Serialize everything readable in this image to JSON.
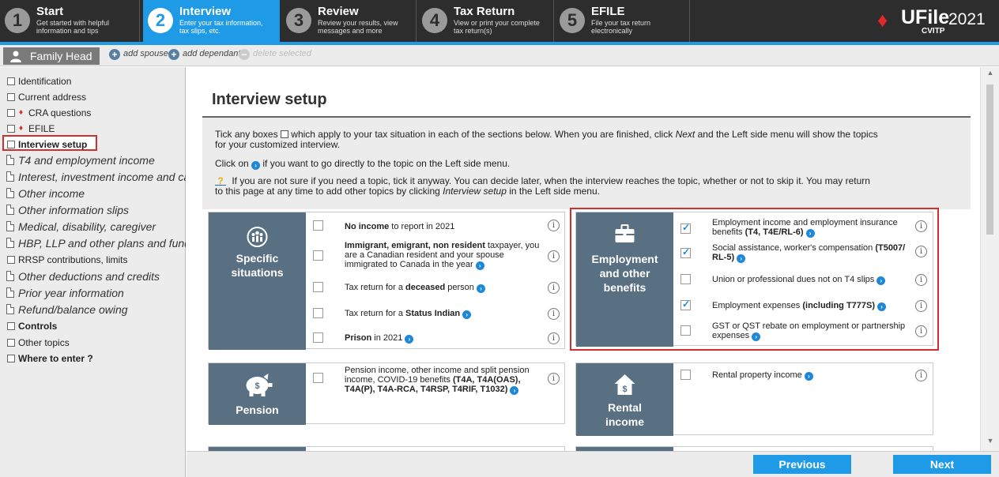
{
  "steps": [
    {
      "num": "1",
      "title": "Start",
      "sub1": "Get started with helpful",
      "sub2": "information and tips",
      "active": false
    },
    {
      "num": "2",
      "title": "Interview",
      "sub1": "Enter your tax information,",
      "sub2": "tax slips, etc.",
      "active": true
    },
    {
      "num": "3",
      "title": "Review",
      "sub1": "Review your results, view",
      "sub2": "messages and more",
      "active": false
    },
    {
      "num": "4",
      "title": "Tax Return",
      "sub1": "View or print your complete",
      "sub2": "tax return(s)",
      "active": false
    },
    {
      "num": "5",
      "title": "EFILE",
      "sub1": "File your tax return",
      "sub2": "electronically",
      "active": false
    }
  ],
  "logo": {
    "brand": "UFile",
    "year": "2021",
    "tag": "CVITP"
  },
  "family": {
    "tab": "Family Head",
    "add_spouse": "add spouse",
    "add_dependant": "add dependant",
    "delete_selected": "delete selected"
  },
  "nav": [
    {
      "label": "Identification",
      "icon": "box",
      "style": "normal"
    },
    {
      "label": "Current address",
      "icon": "box",
      "style": "normal"
    },
    {
      "label": "CRA questions",
      "icon": "box",
      "leaf": true,
      "style": "normal"
    },
    {
      "label": "EFILE",
      "icon": "box",
      "leaf": true,
      "style": "normal"
    },
    {
      "label": "Interview setup",
      "icon": "box",
      "style": "bold"
    },
    {
      "label": "T4 and employment income",
      "icon": "doc",
      "style": "big"
    },
    {
      "label": "Interest, investment income and carrying charges",
      "icon": "doc",
      "style": "big"
    },
    {
      "label": "Other income",
      "icon": "doc",
      "style": "big"
    },
    {
      "label": "Other information slips",
      "icon": "doc",
      "style": "big"
    },
    {
      "label": "Medical, disability, caregiver",
      "icon": "doc",
      "style": "big"
    },
    {
      "label": "HBP, LLP and other plans and funds",
      "icon": "doc",
      "style": "big"
    },
    {
      "label": "RRSP contributions, limits",
      "icon": "box",
      "style": "normal"
    },
    {
      "label": "Other deductions and credits",
      "icon": "doc",
      "style": "big"
    },
    {
      "label": "Prior year information",
      "icon": "doc",
      "style": "big"
    },
    {
      "label": "Refund/balance owing",
      "icon": "doc",
      "style": "big"
    },
    {
      "label": "Controls",
      "icon": "box",
      "style": "bold"
    },
    {
      "label": "Other topics",
      "icon": "box",
      "style": "normal"
    },
    {
      "label": "Where to enter ?",
      "icon": "box",
      "style": "bold"
    }
  ],
  "page_title": "Interview setup",
  "info": {
    "p1a": "Tick any boxes",
    "p1b": "which apply to your tax situation in each of the sections below. When you are finished, click",
    "p1c": "Next",
    "p1d": "and the Left side menu will show the topics",
    "p1e": "for your customized interview.",
    "p2a": "Click on",
    "p2b": "if you want to go directly to the topic on the Left side menu.",
    "p3a": "If you are not sure if you need a topic, tick it anyway. You can decide later, when the interview reaches the topic, whether or not to skip it. You may return",
    "p3b": "to this page at any time to add other topics by clicking",
    "p3c": "Interview setup",
    "p3d": "in the Left side menu."
  },
  "specific": {
    "title1": "Specific",
    "title2": "situations",
    "r1b": "No income",
    "r1t": "to report in 2021",
    "r2b": "Immigrant, emigrant, non resident",
    "r2t": "taxpayer, you are a Canadian resident and your spouse immigrated to Canada in the year",
    "r3t": "Tax return for a",
    "r3b": "deceased",
    "r3t2": "person",
    "r4t": "Tax return for a",
    "r4b": "Status Indian",
    "r5b": "Prison",
    "r5t": "in 2021"
  },
  "employment": {
    "title1": "Employment",
    "title2": "and other",
    "title3": "benefits",
    "r1t": "Employment income and employment insurance benefits",
    "r1b": "(T4, T4E/RL-6)",
    "r2t": "Social assistance, worker's compensation",
    "r2b": "(T5007/ RL-5)",
    "r3t": "Union or professional dues not on T4 slips",
    "r4t": "Employment expenses",
    "r4b": "(including T777S)",
    "r5t": "GST or QST rebate on employment or partnership expenses",
    "checked": [
      true,
      true,
      false,
      true,
      false
    ]
  },
  "pension": {
    "title": "Pension",
    "r1t": "Pension income, other income and split pension income, COVID-19 benefits",
    "r1b": "(T4A, T4A(OAS), T4A(P), T4A-RCA, T4RSP, T4RIF, T1032)"
  },
  "rental": {
    "title1": "Rental",
    "title2": "income",
    "r1t": "Rental property income"
  },
  "buttons": {
    "previous": "Previous",
    "next": "Next"
  }
}
